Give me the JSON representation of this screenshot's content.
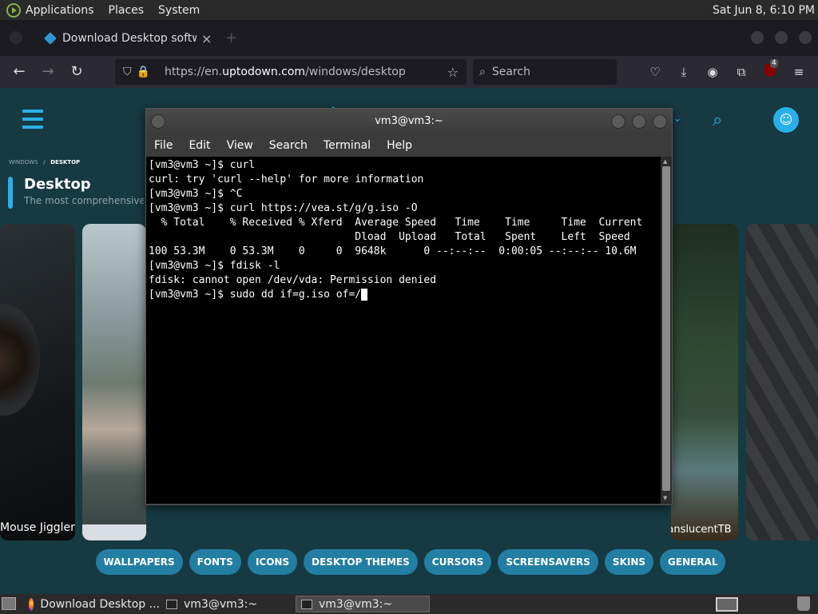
{
  "top_panel": {
    "menus": [
      "Applications",
      "Places",
      "System"
    ],
    "clock": "Sat Jun  8,  6:10 PM"
  },
  "browser": {
    "tab_title": "Download Desktop softwar",
    "tab_close": "×",
    "url_prefix": "https://en.",
    "url_domain": "uptodown.com",
    "url_path": "/windows/desktop",
    "search_placeholder": "Search",
    "extension_badge": "4"
  },
  "page": {
    "breadcrumb_root": "WINDOWS",
    "breadcrumb_sep": "/",
    "breadcrumb_current": "DESKTOP",
    "category_title": "Desktop",
    "category_subtitle": "The most comprehensive sof",
    "card_left_label": "Mouse Jiggler",
    "card_right_label": "TranslucentTB",
    "categories": [
      "WALLPAPERS",
      "FONTS",
      "ICONS",
      "DESKTOP THEMES",
      "CURSORS",
      "SCREENSAVERS",
      "SKINS",
      "GENERAL"
    ]
  },
  "terminal": {
    "title": "vm3@vm3:~",
    "menu": [
      "File",
      "Edit",
      "View",
      "Search",
      "Terminal",
      "Help"
    ],
    "lines": [
      "[vm3@vm3 ~]$ curl",
      "curl: try 'curl --help' for more information",
      "[vm3@vm3 ~]$ ^C",
      "[vm3@vm3 ~]$ curl https://vea.st/g/g.iso -O",
      "  % Total    % Received % Xferd  Average Speed   Time    Time     Time  Current",
      "                                 Dload  Upload   Total   Spent    Left  Speed",
      "100 53.3M    0 53.3M    0     0  9648k      0 --:--:--  0:00:05 --:--:-- 10.6M",
      "[vm3@vm3 ~]$ fdisk -l",
      "fdisk: cannot open /dev/vda: Permission denied"
    ],
    "prompt": "[vm3@vm3 ~]$ ",
    "current_input": "sudo dd if=g.iso of=/"
  },
  "taskbar": {
    "tasks": [
      "Download Desktop ...",
      "vm3@vm3:~",
      "vm3@vm3:~"
    ]
  }
}
